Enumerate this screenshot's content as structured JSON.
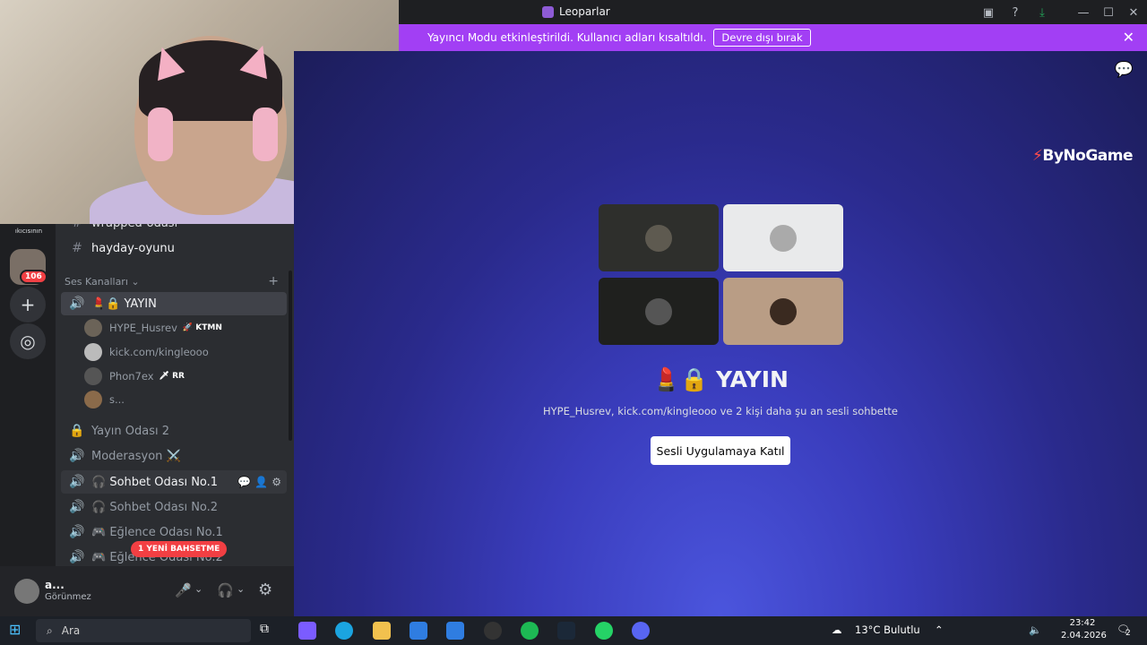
{
  "window": {
    "title": "Leoparlar"
  },
  "banner": {
    "message": "Yayıncı Modu etkinleştirildi. Kullanıcı adları kısaltıldı.",
    "button": "Devre dışı bırak",
    "close": "✕"
  },
  "servers": {
    "label": "ıkıcısının",
    "badge": "106"
  },
  "sidebar": {
    "partial_channel": "wrapped-odası",
    "text_channel": "hayday-oyunu",
    "category": "Ses Kanalları",
    "active_channel": "💄🔒 YAYIN",
    "users": [
      {
        "name": "HYPE_Husrev",
        "tag": "🚀 KTMN"
      },
      {
        "name": "kick.com/kingleooo",
        "tag": ""
      },
      {
        "name": "Phon7ex",
        "tag": "🗡 RR"
      },
      {
        "name": "s...",
        "tag": ""
      }
    ],
    "channels": [
      {
        "name": "Yayın Odası 2"
      },
      {
        "name": "Moderasyon ⚔️"
      },
      {
        "name": "🎧 Sohbet Odası No.1"
      },
      {
        "name": "🎧 Sohbet Odası No.2"
      },
      {
        "name": "🎮 Eğlence Odası No.1"
      },
      {
        "name": "🎮 Eğlence Odası No.2"
      }
    ],
    "mention_badge": "1 YENİ BAHSETME"
  },
  "user_panel": {
    "name": "a...",
    "status": "Görünmez"
  },
  "main": {
    "brand_prefix": "⚡",
    "brand": "ByNoGame",
    "channel_title": "💄🔒 YAYIN",
    "subtitle": "HYPE_Husrev, kick.com/kingleooo ve 2 kişi daha şu an sesli sohbette",
    "join_button": "Sesli Uygulamaya Katıl"
  },
  "taskbar": {
    "search_placeholder": "Ara",
    "weather": "13°C  Bulutlu",
    "time": "23:42",
    "date": "2.04.2026",
    "notif_count": "2"
  }
}
